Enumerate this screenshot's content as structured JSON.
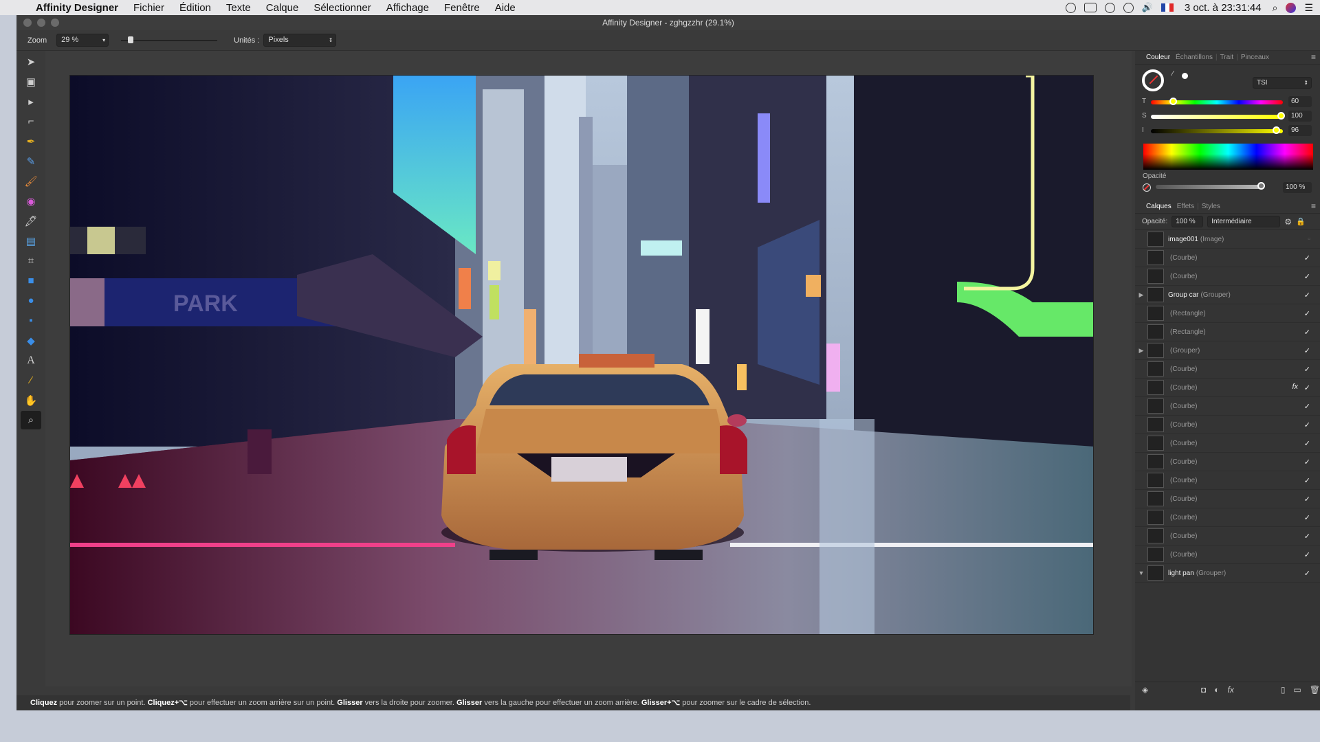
{
  "menubar": {
    "app_name": "Affinity Designer",
    "menus": [
      "Fichier",
      "Édition",
      "Texte",
      "Calque",
      "Sélectionner",
      "Affichage",
      "Fenêtre",
      "Aide"
    ],
    "clock": "3 oct. à 23:31:44"
  },
  "window": {
    "title": "Affinity Designer - zghgzzhr (29.1%)"
  },
  "context_toolbar": {
    "zoom_label": "Zoom",
    "zoom_value": "29 %",
    "units_label": "Unités :",
    "units_value": "Pixels"
  },
  "tools": [
    "move-tool",
    "artboard-tool",
    "node-tool",
    "corner-tool",
    "pen-tool",
    "pencil-tool",
    "brush-tool",
    "fill-tool",
    "transparency-tool",
    "place-image-tool",
    "crop-tool",
    "rectangle-tool",
    "ellipse-tool",
    "rounded-rectangle-tool",
    "shape-tool",
    "text-tool",
    "color-picker-tool",
    "view-tool",
    "zoom-tool"
  ],
  "color_panel": {
    "tabs": [
      "Couleur",
      "Échantillons",
      "Trait",
      "Pinceaux"
    ],
    "model": "TSI",
    "hue_label": "T",
    "hue_value": "60",
    "sat_label": "S",
    "sat_value": "100",
    "int_label": "I",
    "int_value": "96",
    "opacity_label": "Opacité",
    "opacity_value": "100 %"
  },
  "layers_panel": {
    "tabs": [
      "Calques",
      "Effets",
      "Styles"
    ],
    "opacity_label": "Opacité:",
    "opacity_value": "100 %",
    "blend_mode": "Intermédiaire",
    "layers": [
      {
        "name": "image001",
        "type": "(Image)",
        "expand": "",
        "visible": false,
        "fx": false
      },
      {
        "name": "",
        "type": "(Courbe)",
        "expand": "",
        "visible": true,
        "fx": false
      },
      {
        "name": "",
        "type": "(Courbe)",
        "expand": "",
        "visible": true,
        "fx": false
      },
      {
        "name": "Group car",
        "type": "(Grouper)",
        "expand": "▶",
        "visible": true,
        "fx": false
      },
      {
        "name": "",
        "type": "(Rectangle)",
        "expand": "",
        "visible": true,
        "fx": false
      },
      {
        "name": "",
        "type": "(Rectangle)",
        "expand": "",
        "visible": true,
        "fx": false
      },
      {
        "name": "",
        "type": "(Grouper)",
        "expand": "▶",
        "visible": true,
        "fx": false
      },
      {
        "name": "",
        "type": "(Courbe)",
        "expand": "",
        "visible": true,
        "fx": false
      },
      {
        "name": "",
        "type": "(Courbe)",
        "expand": "",
        "visible": true,
        "fx": true
      },
      {
        "name": "",
        "type": "(Courbe)",
        "expand": "",
        "visible": true,
        "fx": false
      },
      {
        "name": "",
        "type": "(Courbe)",
        "expand": "",
        "visible": true,
        "fx": false
      },
      {
        "name": "",
        "type": "(Courbe)",
        "expand": "",
        "visible": true,
        "fx": false
      },
      {
        "name": "",
        "type": "(Courbe)",
        "expand": "",
        "visible": true,
        "fx": false
      },
      {
        "name": "",
        "type": "(Courbe)",
        "expand": "",
        "visible": true,
        "fx": false
      },
      {
        "name": "",
        "type": "(Courbe)",
        "expand": "",
        "visible": true,
        "fx": false
      },
      {
        "name": "",
        "type": "(Courbe)",
        "expand": "",
        "visible": true,
        "fx": false
      },
      {
        "name": "",
        "type": "(Courbe)",
        "expand": "",
        "visible": true,
        "fx": false
      },
      {
        "name": "",
        "type": "(Courbe)",
        "expand": "",
        "visible": true,
        "fx": false
      },
      {
        "name": "light pan",
        "type": "(Grouper)",
        "expand": "▼",
        "visible": true,
        "fx": false
      }
    ]
  },
  "artwork": {
    "sign_text": "PARK"
  },
  "status": {
    "b1": "Cliquez",
    "t1": " pour zoomer sur un point. ",
    "b2": "Cliquez+⌥",
    "t2": " pour effectuer un zoom arrière sur un point. ",
    "b3": "Glisser",
    "t3": " vers la droite pour zoomer. ",
    "b4": "Glisser",
    "t4": " vers la gauche pour effectuer un zoom arrière. ",
    "b5": "Glisser+⌥",
    "t5": " pour zoomer sur le cadre de sélection."
  }
}
